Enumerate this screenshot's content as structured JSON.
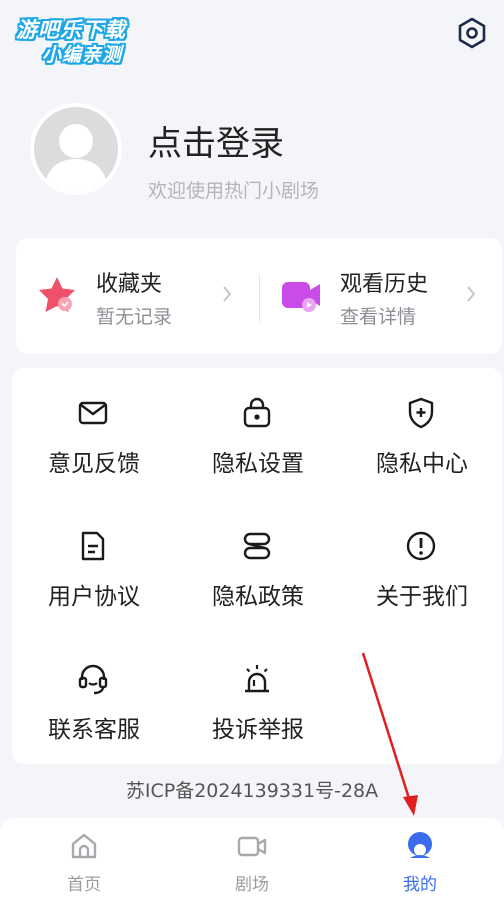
{
  "watermark": {
    "line1": "游吧乐下载",
    "line2": "小编亲测"
  },
  "header": {
    "settings_icon": "settings-hex-icon"
  },
  "profile": {
    "title": "点击登录",
    "subtitle": "欢迎使用热门小剧场"
  },
  "quick": [
    {
      "title": "收藏夹",
      "sub": "暂无记录",
      "icon": "star-icon",
      "color": "#f0516a"
    },
    {
      "title": "观看历史",
      "sub": "查看详情",
      "icon": "video-icon",
      "color": "#c94be8"
    }
  ],
  "menu": [
    {
      "label": "意见反馈",
      "icon": "mail-icon"
    },
    {
      "label": "隐私设置",
      "icon": "lock-icon"
    },
    {
      "label": "隐私中心",
      "icon": "shield-icon"
    },
    {
      "label": "用户协议",
      "icon": "document-icon"
    },
    {
      "label": "隐私政策",
      "icon": "policy-icon"
    },
    {
      "label": "关于我们",
      "icon": "info-icon"
    },
    {
      "label": "联系客服",
      "icon": "headset-icon"
    },
    {
      "label": "投诉举报",
      "icon": "alarm-icon"
    }
  ],
  "footer": {
    "icp": "苏ICP备2024139331号-28A"
  },
  "tabs": [
    {
      "label": "首页",
      "icon": "home-icon",
      "active": false
    },
    {
      "label": "剧场",
      "icon": "camera-icon",
      "active": false
    },
    {
      "label": "我的",
      "icon": "profile-icon",
      "active": true
    }
  ],
  "colors": {
    "accent": "#3b6cf0",
    "annotation": "#e02020"
  }
}
